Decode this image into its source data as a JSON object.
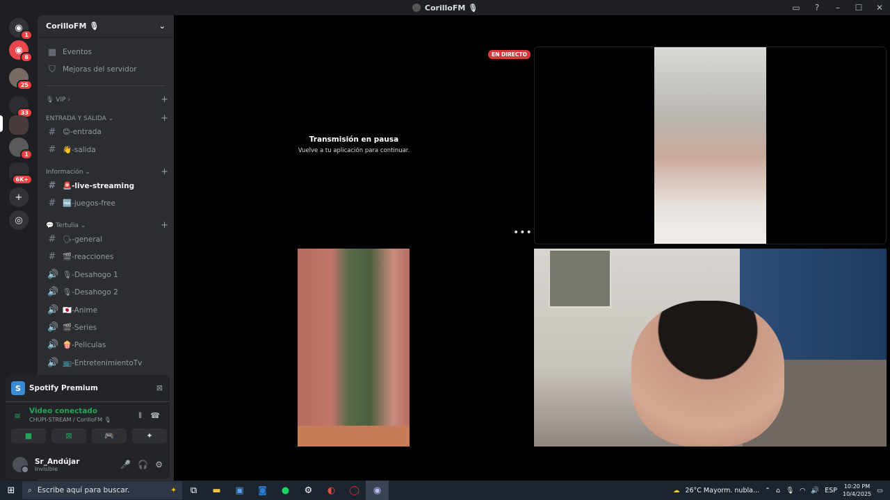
{
  "window": {
    "title": "CorilloFM 🎙"
  },
  "rail": {
    "servers": [
      {
        "name": "direct-messages",
        "badge": "1"
      },
      {
        "name": "server-red",
        "badge": "8"
      },
      {
        "name": "server-3",
        "badge": "25"
      },
      {
        "name": "server-4",
        "badge": "33"
      },
      {
        "name": "server-corillofm",
        "badge": ""
      },
      {
        "name": "server-6",
        "badge": "1"
      },
      {
        "name": "server-folder",
        "badge": "6K+"
      }
    ]
  },
  "server": {
    "name": "CorilloFM 🎙",
    "top_items": [
      {
        "label": "Eventos",
        "icon": "calendar-icon"
      },
      {
        "label": "Mejoras del servidor",
        "icon": "shield-icon"
      }
    ],
    "categories": [
      {
        "label": "🎙 VIP ›"
      },
      {
        "label": "ENTRADA Y SALIDA ⌄"
      },
      {
        "label": "Información ⌄"
      },
      {
        "label": "💬 Tertulia ⌄"
      }
    ],
    "channels": [
      {
        "label": "😊-entrada",
        "type": "text"
      },
      {
        "label": "👋-salida",
        "type": "text"
      },
      {
        "label": "🚨-live-streaming",
        "type": "text",
        "active": true
      },
      {
        "label": "🆓-juegos-free",
        "type": "text"
      },
      {
        "label": "🗣-general",
        "type": "text"
      },
      {
        "label": "🎬-reacciones",
        "type": "text"
      },
      {
        "label": "🎙-Desahogo 1",
        "type": "voice"
      },
      {
        "label": "🎙-Desahogo 2",
        "type": "voice"
      },
      {
        "label": "🇯🇵-Anime",
        "type": "voice"
      },
      {
        "label": "🎬-Series",
        "type": "voice"
      },
      {
        "label": "🍿-Peliculas",
        "type": "voice"
      },
      {
        "label": "📺-EntretenimientoTv",
        "type": "voice"
      }
    ]
  },
  "activity": {
    "label": "Spotify Premium"
  },
  "voice": {
    "status": "Video conectado",
    "channel": "CHUPI-STREAM / CorilloFM 🎙"
  },
  "user": {
    "name": "Sr_Andújar",
    "status": "Invisible"
  },
  "stage": {
    "live_badge": "EN DIRECTO",
    "paused_title": "Transmisión en pausa",
    "paused_sub": "Vuelve a tu aplicación para continuar.",
    "more": "•••"
  },
  "taskbar": {
    "search_placeholder": "Escribe aquí para buscar.",
    "weather": "26°C  Mayorm. nubla...",
    "lang": "ESP",
    "time": "10:20 PM",
    "date": "10/4/2025"
  },
  "colors": {
    "accent": "#5865f2",
    "live": "#da373c",
    "connected": "#23a55a"
  }
}
